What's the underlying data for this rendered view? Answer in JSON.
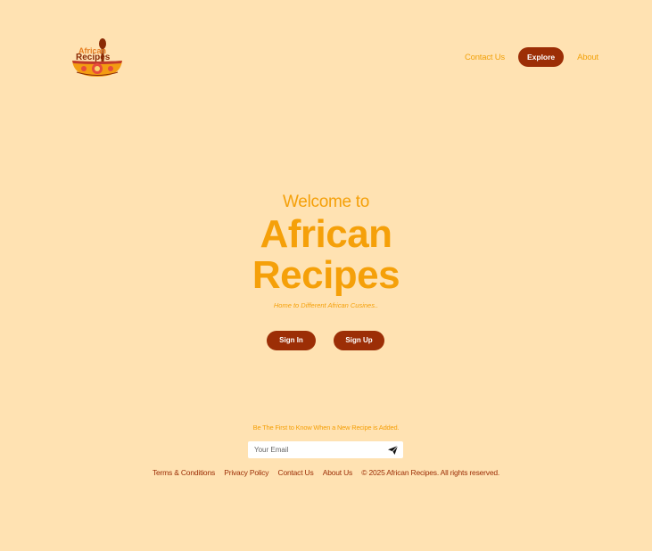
{
  "header": {
    "logo_text_line1": "African",
    "logo_text_line2": "Recipes",
    "nav": {
      "contact": "Contact Us",
      "explore": "Explore",
      "about": "About"
    }
  },
  "hero": {
    "welcome": "Welcome to",
    "title_line1": "African",
    "title_line2": "Recipes",
    "tagline": "Home to Different African Cusines..",
    "signin_label": "Sign In",
    "signup_label": "Sign Up"
  },
  "subscribe": {
    "prompt": "Be The First to Know When a New Recipe is Added.",
    "email_placeholder": "Your Email",
    "send_icon": "paper-plane-icon"
  },
  "footer": {
    "links": [
      "Terms & Conditions",
      "Privacy Policy",
      "Contact Us",
      "About Us"
    ],
    "copyright": "© 2025 African Recipes. All rights reserved."
  },
  "colors": {
    "background": "#ffe2b2",
    "accent": "#f5a009",
    "primary": "#9c2e06"
  }
}
